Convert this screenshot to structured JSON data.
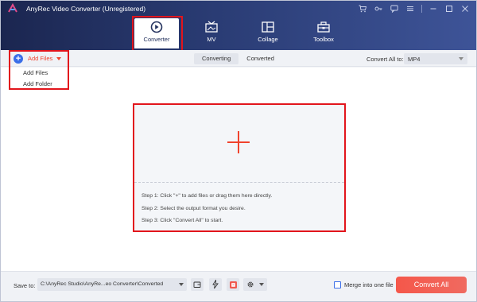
{
  "window": {
    "title": "AnyRec Video Converter (Unregistered)"
  },
  "nav": {
    "tabs": [
      {
        "label": "Converter",
        "icon": "converter-icon",
        "active": true
      },
      {
        "label": "MV",
        "icon": "mv-icon",
        "active": false
      },
      {
        "label": "Collage",
        "icon": "collage-icon",
        "active": false
      },
      {
        "label": "Toolbox",
        "icon": "toolbox-icon",
        "active": false
      }
    ]
  },
  "toolbar": {
    "add_files_label": "Add Files",
    "segments": [
      {
        "label": "Converting",
        "active": true
      },
      {
        "label": "Converted",
        "active": false
      }
    ],
    "convert_all_to_label": "Convert All to:",
    "format_value": "MP4"
  },
  "add_menu": {
    "items": [
      "Add Files",
      "Add Folder"
    ]
  },
  "drop_zone": {
    "steps": [
      "Step 1: Click \"+\" to add files or drag them here directly.",
      "Step 2: Select the output format you desire.",
      "Step 3: Click \"Convert All\" to start."
    ]
  },
  "bottom": {
    "save_to_label": "Save to:",
    "path": "C:\\AnyRec Studio\\AnyRe...eo Converter\\Converted",
    "merge_label": "Merge into one file",
    "convert_all_button": "Convert All"
  },
  "colors": {
    "accent": "#f0432d",
    "header_dark": "#1b2650",
    "highlight": "#e2151c",
    "blue": "#3a6ee8"
  }
}
